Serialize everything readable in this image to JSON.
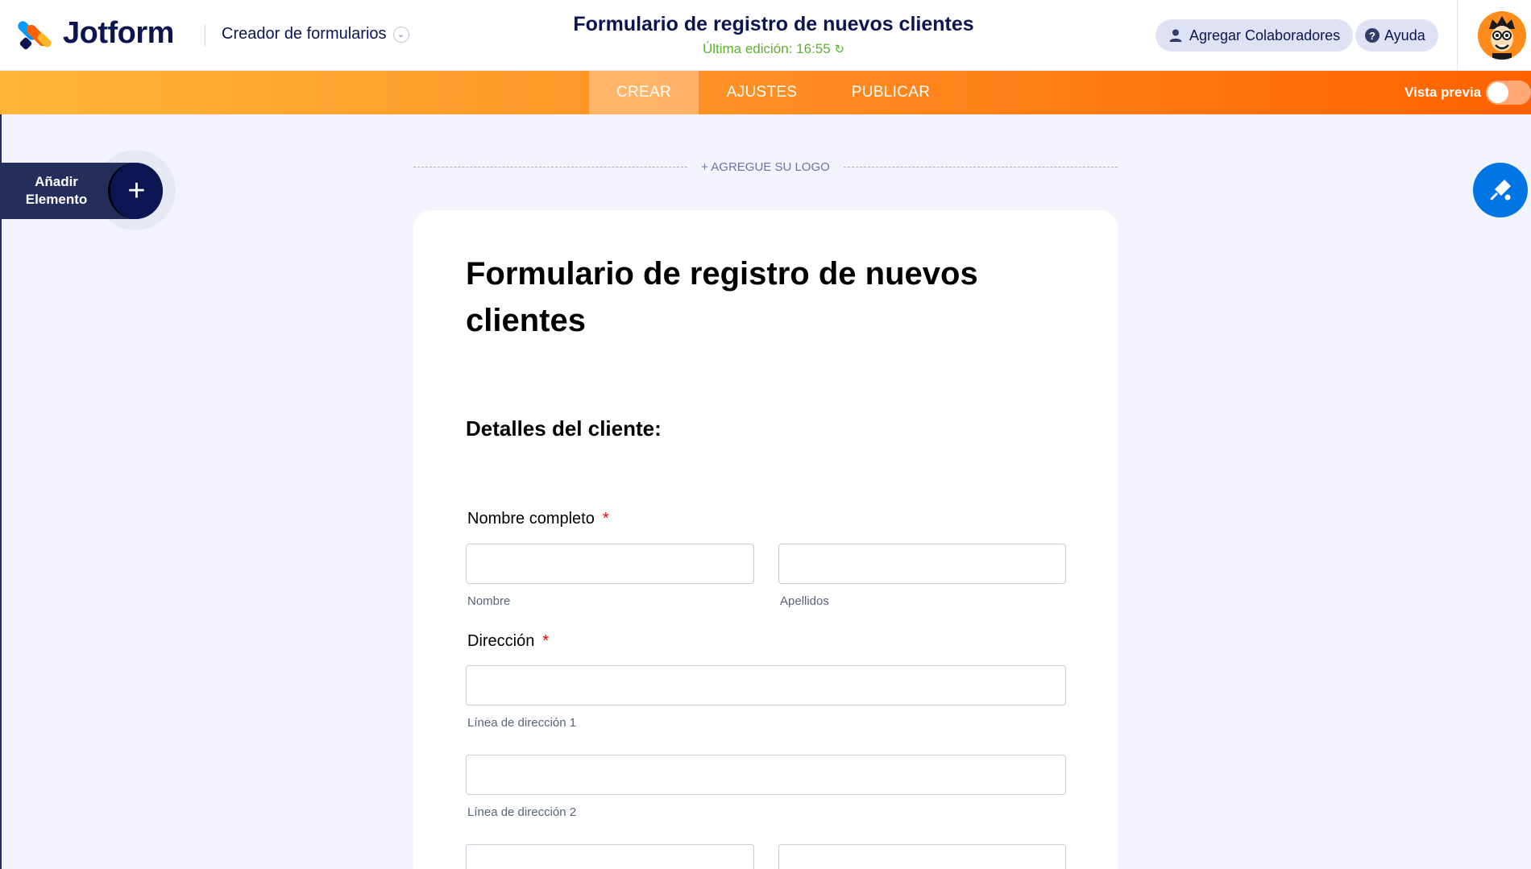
{
  "header": {
    "logo_text": "Jotform",
    "builder_menu": "Creador de formularios",
    "form_title": "Formulario de registro de nuevos clientes",
    "last_edit": "Última edición: 16:55",
    "collab_label": "Agregar Colaboradores",
    "help_label": "Ayuda"
  },
  "nav": {
    "tabs": [
      {
        "label": "CREAR",
        "active": true
      },
      {
        "label": "AJUSTES",
        "active": false
      },
      {
        "label": "PUBLICAR",
        "active": false
      }
    ],
    "preview_label": "Vista previa"
  },
  "sidebar": {
    "add_element_label_1": "Añadir",
    "add_element_label_2": "Elemento"
  },
  "form": {
    "add_logo": "+ AGREGUE SU LOGO",
    "heading": "Formulario de registro de nuevos clientes",
    "section": "Detalles del cliente:",
    "full_name_label": "Nombre completo",
    "first_name_sub": "Nombre",
    "last_name_sub": "Apellidos",
    "address_label": "Dirección",
    "address_line1_sub": "Línea de dirección 1",
    "address_line2_sub": "Línea de dirección 2",
    "required_mark": "*"
  },
  "colors": {
    "brand_navy": "#0a1551",
    "orange_start": "#ffb53a",
    "orange_end": "#ff6100",
    "accent_blue": "#0075e3",
    "edit_green": "#5ab22e"
  }
}
